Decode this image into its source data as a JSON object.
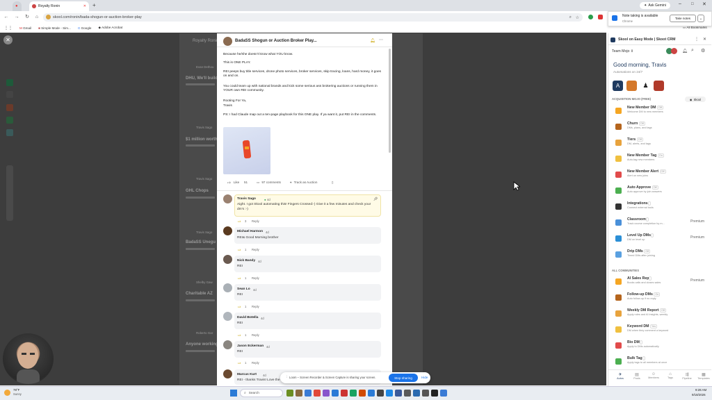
{
  "browser": {
    "tab_title": "Royalty Ronin",
    "url": "skool.com/ronin/bada-shogun-or-auction-broker-play",
    "ask_gemini": "Ask Gemini",
    "bookmarks": [
      "Gmail",
      "Simple Mode - Sim...",
      "Google",
      "Adobe Acrobat"
    ],
    "all_bookmarks": "All Bookmarks"
  },
  "notification": {
    "title": "Note taking is available",
    "subtitle": "Chrome",
    "button": "Take notes"
  },
  "background_feed": {
    "titles": [
      "DHU, We'll build",
      "$1 million worth",
      "GHL Chops",
      "BadaSS Unegu",
      "Charitable AZ",
      "Anyone working"
    ],
    "users": [
      "Royalty Ronin",
      "Evan Dethou",
      "Travis Sago",
      "Travis Sago",
      "Travis Sago",
      "Shelby Gaw",
      "Roberto Gar"
    ]
  },
  "post": {
    "title": "BadaSS Shogun or Auction Broker Play...",
    "para1": "Because he/she doesn't know what YOU know.",
    "para2": "This is ONE PLAY.",
    "para3": "REI peeps buy title services, drone photo services, broker services, skip tracing, loans, hard money, it goes on and on.",
    "para4": "You could team up with national brands and kick some serious ass brokering auctions or running them in YOUR own REI community.",
    "sign1": "Rooting For Ya,",
    "sign2": "Travis",
    "ps": "PS: I had Claude map out a ten-page playbook for this ONE play. If ya want it, put REI in the comments.",
    "like": "Like",
    "likes": "51",
    "comments": "97 comments",
    "track": "Track as Auction"
  },
  "comments": [
    {
      "name": "Travis Sago",
      "time": "4d",
      "text": "Aight. I got Skool automating this! Fingers Crossed:-) Give it a few minutes and check your dm's :-)",
      "likes": "3",
      "reply": "Reply"
    },
    {
      "name": "Michael Harmon",
      "time": "4d",
      "text": "REI& Good Morning brother",
      "likes": "1",
      "reply": "Reply"
    },
    {
      "name": "Nick Bandy",
      "time": "4d",
      "text": "REI",
      "likes": "1",
      "reply": "Reply"
    },
    {
      "name": "Sean Lo",
      "time": "4d",
      "text": "REI",
      "likes": "1",
      "reply": "Reply"
    },
    {
      "name": "David Botella",
      "time": "4d",
      "text": "REI",
      "likes": "1",
      "reply": "Reply"
    },
    {
      "name": "Jason Eckerman",
      "time": "4d",
      "text": "REI",
      "likes": "1",
      "reply": "Reply"
    },
    {
      "name": "Marcus Kurt",
      "time": "4d",
      "text": "REI - thanks Travis! Love the",
      "likes": "",
      "reply": ""
    }
  ],
  "share_bar": {
    "text": "Loom – Screen Recorder & Screen Capture is sharing your screen.",
    "stop": "Stop sharing",
    "hide": "Hide"
  },
  "panel": {
    "header": "Skool on Easy Mode | Skoot CRM",
    "team": "Team Mojo",
    "greeting": "Good morning, Travis",
    "automations": "Automations on 24/7",
    "section1": "ACQUISITION MOJO (FREE)",
    "skool_label": "Skool",
    "items": [
      {
        "title": "New Member DM",
        "badge": "Off",
        "sub": "Welcome DM to new members",
        "right": ""
      },
      {
        "title": "Churn",
        "badge": "Off",
        "sub": "DMs, plans, and tags",
        "right": ""
      },
      {
        "title": "Tiers",
        "badge": "Off",
        "sub": "DM, alerts, and tags",
        "right": ""
      },
      {
        "title": "New Member Tag",
        "badge": "On",
        "sub": "Auto-tag new members",
        "right": ""
      },
      {
        "title": "New Member Alert",
        "badge": "Off",
        "sub": "Alert on new joins",
        "right": ""
      },
      {
        "title": "Auto Approve",
        "badge": "Off",
        "sub": "Auto approve by join answers",
        "right": ""
      },
      {
        "title": "Integrations",
        "badge": "",
        "sub": "Connect external tools",
        "right": ""
      },
      {
        "title": "Classroom",
        "badge": "",
        "sub": "Track course completion by m...",
        "right": "Premium"
      },
      {
        "title": "Level Up DMs",
        "badge": "",
        "sub": "DM on level up",
        "right": "Premium"
      },
      {
        "title": "Drip DMs",
        "badge": "Off",
        "sub": "Timed DMs after joining",
        "right": ""
      }
    ],
    "section2": "ALL COMMUNITIES",
    "items2": [
      {
        "title": "AI Sales Rep",
        "badge": "",
        "sub": "Books calls and closes sales",
        "right": "Premium"
      },
      {
        "title": "Follow-up DMs",
        "badge": "On",
        "sub": "Auto follow-up if no reply",
        "right": ""
      },
      {
        "title": "Weekly DM Report",
        "badge": "Off",
        "sub": "Apply rules and AI insights, weekly",
        "right": ""
      },
      {
        "title": "Keyword DM",
        "badge": "Yes",
        "sub": "DM when they comment a keyword",
        "right": ""
      },
      {
        "title": "Bio DM",
        "badge": "",
        "sub": "Apply to DMs automatically",
        "right": ""
      },
      {
        "title": "Bulk Tag",
        "badge": "",
        "sub": "Apply tags to all members at once",
        "right": ""
      }
    ],
    "nav": [
      "Autos",
      "Posts",
      "Members",
      "Tags",
      "Pipeline",
      "Templates"
    ]
  },
  "taskbar": {
    "weather": "78°F",
    "weather_sub": "Sunny",
    "search": "Search",
    "time": "9:28 AM",
    "date": "9/18/2026"
  },
  "colors": {
    "accent": "#1a73e8",
    "dim": "#3d3d3d",
    "panel_title": "#1f3a5f"
  }
}
